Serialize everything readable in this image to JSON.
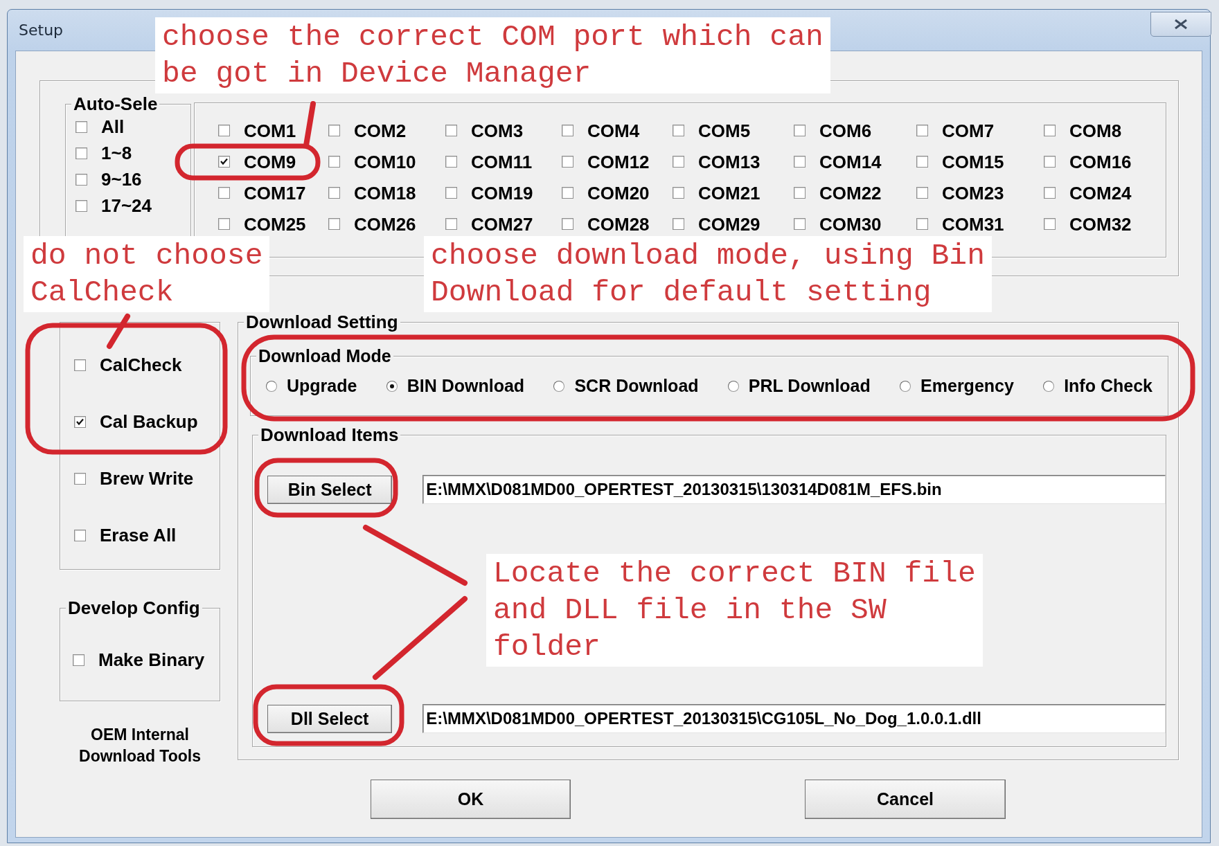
{
  "window": {
    "title": "Setup"
  },
  "auto_select": {
    "title": "Auto-Sele",
    "items": [
      {
        "label": "All",
        "checked": false
      },
      {
        "label": "1~8",
        "checked": false
      },
      {
        "label": "9~16",
        "checked": false
      },
      {
        "label": "17~24",
        "checked": false
      }
    ]
  },
  "com_ports": [
    {
      "label": "COM1",
      "checked": false
    },
    {
      "label": "COM2",
      "checked": false
    },
    {
      "label": "COM3",
      "checked": false
    },
    {
      "label": "COM4",
      "checked": false
    },
    {
      "label": "COM5",
      "checked": false
    },
    {
      "label": "COM6",
      "checked": false
    },
    {
      "label": "COM7",
      "checked": false
    },
    {
      "label": "COM8",
      "checked": false
    },
    {
      "label": "COM9",
      "checked": true
    },
    {
      "label": "COM10",
      "checked": false
    },
    {
      "label": "COM11",
      "checked": false
    },
    {
      "label": "COM12",
      "checked": false
    },
    {
      "label": "COM13",
      "checked": false
    },
    {
      "label": "COM14",
      "checked": false
    },
    {
      "label": "COM15",
      "checked": false
    },
    {
      "label": "COM16",
      "checked": false
    },
    {
      "label": "COM17",
      "checked": false
    },
    {
      "label": "COM18",
      "checked": false
    },
    {
      "label": "COM19",
      "checked": false
    },
    {
      "label": "COM20",
      "checked": false
    },
    {
      "label": "COM21",
      "checked": false
    },
    {
      "label": "COM22",
      "checked": false
    },
    {
      "label": "COM23",
      "checked": false
    },
    {
      "label": "COM24",
      "checked": false
    },
    {
      "label": "COM25",
      "checked": false
    },
    {
      "label": "COM26",
      "checked": false
    },
    {
      "label": "COM27",
      "checked": false
    },
    {
      "label": "COM28",
      "checked": false
    },
    {
      "label": "COM29",
      "checked": false
    },
    {
      "label": "COM30",
      "checked": false
    },
    {
      "label": "COM31",
      "checked": false
    },
    {
      "label": "COM32",
      "checked": false
    }
  ],
  "options": [
    {
      "label": "CalCheck",
      "checked": false
    },
    {
      "label": "Cal Backup",
      "checked": true
    },
    {
      "label": "Brew Write",
      "checked": false
    },
    {
      "label": "Erase All",
      "checked": false
    }
  ],
  "develop_config": {
    "title": "Develop Config",
    "items": [
      {
        "label": "Make Binary",
        "checked": false
      }
    ]
  },
  "footer_text": "OEM Internal Download Tools",
  "download_setting": {
    "title": "Download Setting",
    "mode": {
      "title": "Download Mode",
      "options": [
        {
          "label": "Upgrade",
          "selected": false
        },
        {
          "label": "BIN Download",
          "selected": true
        },
        {
          "label": "SCR Download",
          "selected": false
        },
        {
          "label": "PRL Download",
          "selected": false
        },
        {
          "label": "Emergency",
          "selected": false
        },
        {
          "label": "Info Check",
          "selected": false
        }
      ]
    },
    "items": {
      "title": "Download Items",
      "files": [
        {
          "button": "Bin Select",
          "value": "E:\\MMX\\D081MD00_OPERTEST_20130315\\130314D081M_EFS.bin"
        },
        {
          "button": "Dll Select",
          "value": "E:\\MMX\\D081MD00_OPERTEST_20130315\\CG105L_No_Dog_1.0.0.1.dll"
        }
      ]
    }
  },
  "buttons": [
    "OK",
    "Cancel"
  ],
  "annotations": [
    {
      "lines": [
        "choose the correct COM port which can",
        "be got in Device Manager"
      ]
    },
    {
      "lines": [
        "do not choose",
        "CalCheck"
      ]
    },
    {
      "lines": [
        "choose download mode, using Bin",
        "Download for default setting"
      ]
    },
    {
      "lines": [
        "Locate the correct BIN file",
        "and DLL file in the SW",
        "folder"
      ]
    }
  ]
}
